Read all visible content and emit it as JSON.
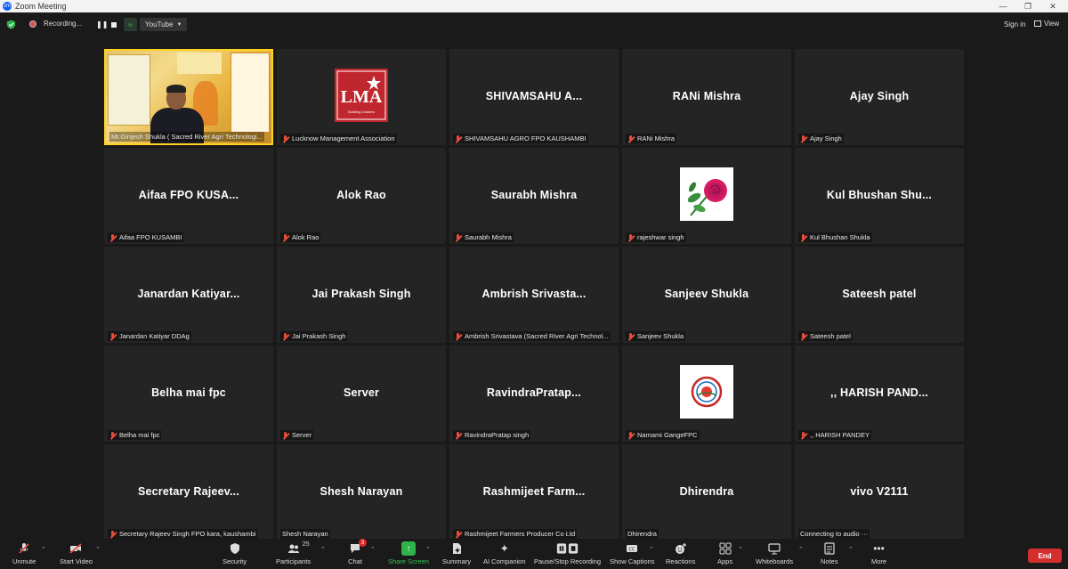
{
  "window": {
    "title": "Zoom Meeting",
    "app_icon": "zm"
  },
  "topbar": {
    "recording_label": "Recording...",
    "stream_target": "YouTube",
    "signin_label": "Sign in",
    "view_label": "View"
  },
  "gallery": [
    {
      "type": "video",
      "label": "Mr.Girijesh Shukla ( Sacred River Agri Technologi...",
      "mic_muted": false,
      "active": true
    },
    {
      "type": "logo",
      "logo_text": "LMA",
      "logo_sub": "Building Leaders",
      "label": "Lucknow Management Association",
      "mic_muted": true
    },
    {
      "type": "name",
      "display": "SHIVAMSAHU A...",
      "label": "SHIVAMSAHU AGRO FPO KAUSHAMBI",
      "mic_muted": true
    },
    {
      "type": "name",
      "display": "RANi Mishra",
      "label": "RANi Mishra",
      "mic_muted": true
    },
    {
      "type": "name",
      "display": "Ajay Singh",
      "label": "Ajay Singh",
      "mic_muted": true
    },
    {
      "type": "name",
      "display": "Aifaa FPO KUSA...",
      "label": "Aifaa FPO KUSAMBI",
      "mic_muted": true
    },
    {
      "type": "name",
      "display": "Alok Rao",
      "label": "Alok Rao",
      "mic_muted": true
    },
    {
      "type": "name",
      "display": "Saurabh Mishra",
      "label": "Saurabh Mishra",
      "mic_muted": true
    },
    {
      "type": "rose",
      "label": "rajeshwar singh",
      "mic_muted": true
    },
    {
      "type": "name",
      "display": "Kul Bhushan Shu...",
      "label": "Kul Bhushan Shukla",
      "mic_muted": true
    },
    {
      "type": "name",
      "display": "Janardan Katiyar...",
      "label": "Janardan Katiyar DDAg",
      "mic_muted": true
    },
    {
      "type": "name",
      "display": "Jai Prakash Singh",
      "label": "Jai Prakash Singh",
      "mic_muted": true
    },
    {
      "type": "name",
      "display": "Ambrish Srivasta...",
      "label": "Ambrish Srivastava (Sacred River Agri Technol...",
      "mic_muted": true
    },
    {
      "type": "name",
      "display": "Sanjeev Shukla",
      "label": "Sanjeev Shukla",
      "mic_muted": true
    },
    {
      "type": "name",
      "display": "Sateesh patel",
      "label": "Sateesh patel",
      "mic_muted": true
    },
    {
      "type": "name",
      "display": "Belha mai fpc",
      "label": "Belha mai fpc",
      "mic_muted": true
    },
    {
      "type": "name",
      "display": "Server",
      "label": "Server",
      "mic_muted": true
    },
    {
      "type": "name",
      "display": "RavindraPratap...",
      "label": "RavindraPratap singh",
      "mic_muted": true
    },
    {
      "type": "namami",
      "label": "Namami GangeFPC",
      "mic_muted": true
    },
    {
      "type": "name",
      "display": ",, HARISH PAND...",
      "label": ",, HARISH PANDEY",
      "mic_muted": true
    },
    {
      "type": "name",
      "display": "Secretary Rajeev...",
      "label": "Secretary Rajeev Singh FPO kara, kaushambi",
      "mic_muted": true
    },
    {
      "type": "name",
      "display": "Shesh Narayan",
      "label": "Shesh Narayan",
      "mic_muted": false
    },
    {
      "type": "name",
      "display": "Rashmijeet Farm...",
      "label": "Rashmijeet Farmers Producer Co Ltd",
      "mic_muted": true
    },
    {
      "type": "name",
      "display": "Dhirendra",
      "label": "Dhirendra",
      "mic_muted": false
    },
    {
      "type": "name",
      "display": "vivo V2111",
      "label": "Connecting to audio ···",
      "mic_muted": false
    }
  ],
  "toolbar": {
    "unmute": "Unmute",
    "start_video": "Start Video",
    "security": "Security",
    "participants": "Participants",
    "participants_count": "25",
    "chat": "Chat",
    "chat_badge": "3",
    "share_screen": "Share Screen",
    "summary": "Summary",
    "ai_companion": "AI Companion",
    "pause_recording": "Pause/Stop Recording",
    "show_captions": "Show Captions",
    "reactions": "Reactions",
    "apps": "Apps",
    "whiteboards": "Whiteboards",
    "notes": "Notes",
    "more": "More",
    "end": "End"
  },
  "colors": {
    "active_border": "#ffd21e",
    "end": "#d32f2f",
    "share": "#2fb34a",
    "muted": "#e74c3c"
  }
}
